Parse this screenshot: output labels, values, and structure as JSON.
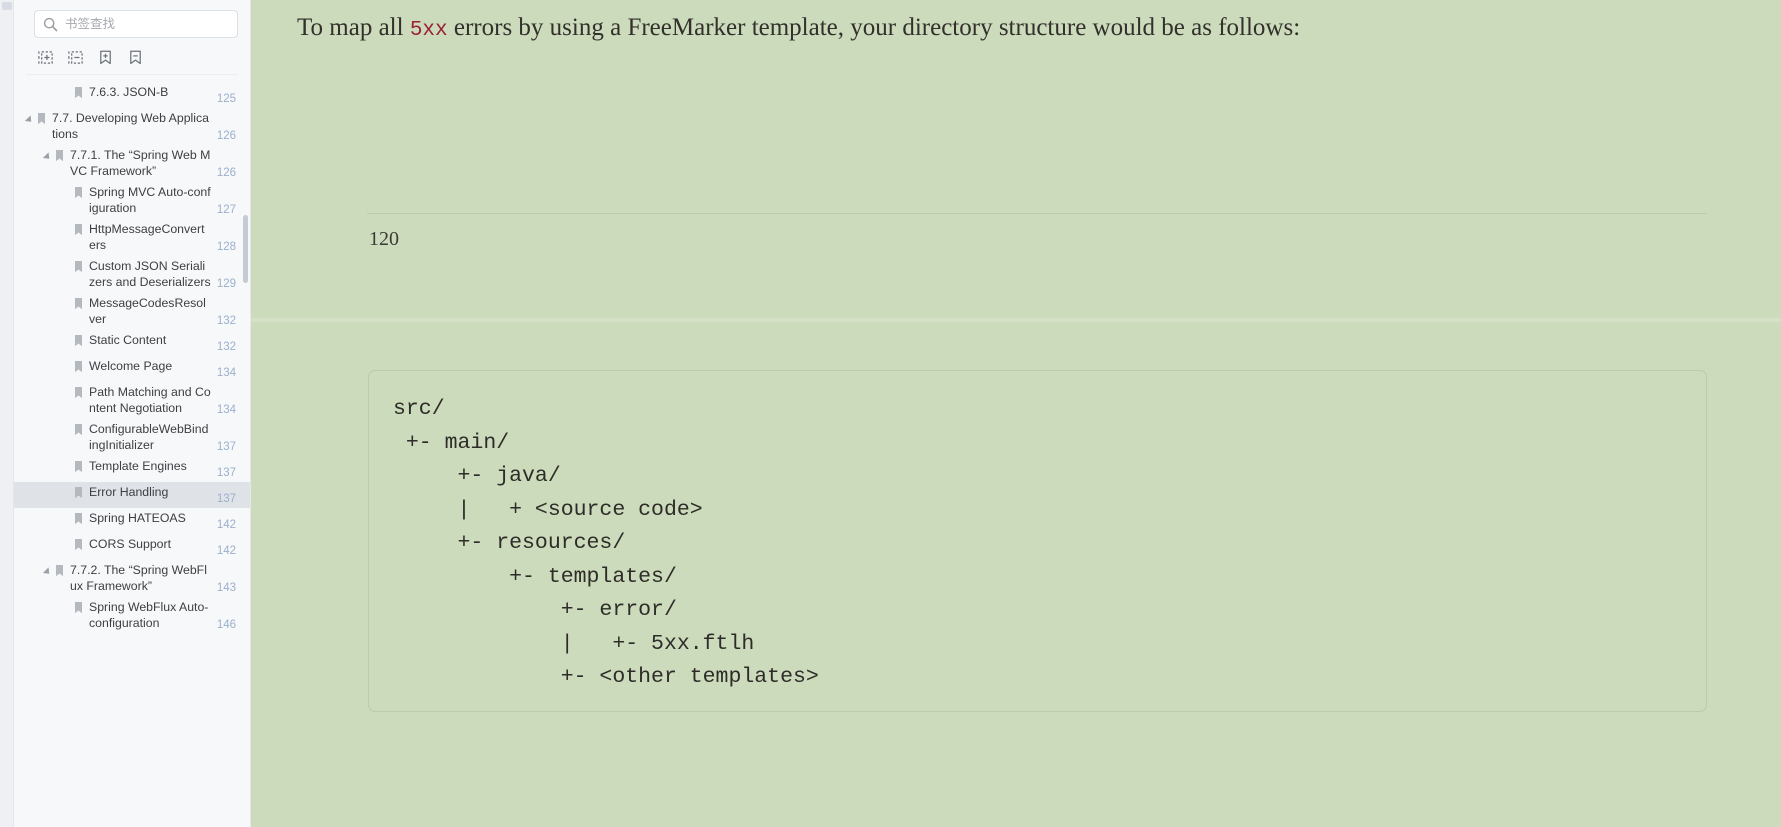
{
  "sidebar": {
    "search": {
      "placeholder": "书签查找",
      "value": "",
      "icon": "search-icon"
    },
    "toolbar": [
      {
        "id": "expand-all",
        "icon": "expand-all-icon",
        "title": "展开全部"
      },
      {
        "id": "collapse-all",
        "icon": "collapse-all-icon",
        "title": "收起全部"
      },
      {
        "id": "add-bookmark",
        "icon": "add-bookmark-icon",
        "title": "添加书签"
      },
      {
        "id": "remove-bookmark",
        "icon": "remove-bookmark-icon",
        "title": "删除书签"
      }
    ],
    "tree": [
      {
        "label": "7.6.3. JSON-B",
        "page": "125",
        "depth": 2,
        "expandable": false,
        "selected": false
      },
      {
        "label": "7.7. Developing Web Applications",
        "page": "126",
        "depth": 0,
        "expandable": true,
        "selected": false
      },
      {
        "label": "7.7.1. The “Spring Web MVC Framework”",
        "page": "126",
        "depth": 1,
        "expandable": true,
        "selected": false
      },
      {
        "label": "Spring MVC Auto-configuration",
        "page": "127",
        "depth": 2,
        "expandable": false,
        "selected": false
      },
      {
        "label": "HttpMessageConverters",
        "page": "128",
        "depth": 2,
        "expandable": false,
        "selected": false
      },
      {
        "label": "Custom JSON Serializers and Deserializers",
        "page": "129",
        "depth": 2,
        "expandable": false,
        "selected": false
      },
      {
        "label": "MessageCodesResolver",
        "page": "132",
        "depth": 2,
        "expandable": false,
        "selected": false
      },
      {
        "label": "Static Content",
        "page": "132",
        "depth": 2,
        "expandable": false,
        "selected": false
      },
      {
        "label": "Welcome Page",
        "page": "134",
        "depth": 2,
        "expandable": false,
        "selected": false
      },
      {
        "label": "Path Matching and Content Negotiation",
        "page": "134",
        "depth": 2,
        "expandable": false,
        "selected": false
      },
      {
        "label": "ConfigurableWebBindingInitializer",
        "page": "137",
        "depth": 2,
        "expandable": false,
        "selected": false
      },
      {
        "label": "Template Engines",
        "page": "137",
        "depth": 2,
        "expandable": false,
        "selected": false
      },
      {
        "label": "Error Handling",
        "page": "137",
        "depth": 2,
        "expandable": false,
        "selected": true
      },
      {
        "label": "Spring HATEOAS",
        "page": "142",
        "depth": 2,
        "expandable": false,
        "selected": false
      },
      {
        "label": "CORS Support",
        "page": "142",
        "depth": 2,
        "expandable": false,
        "selected": false
      },
      {
        "label": "7.7.2. The “Spring WebFlux Framework”",
        "page": "143",
        "depth": 1,
        "expandable": true,
        "selected": false
      },
      {
        "label": "Spring WebFlux Auto-configuration",
        "page": "146",
        "depth": 2,
        "expandable": false,
        "selected": false
      }
    ]
  },
  "viewer": {
    "page_one": {
      "paragraph_before": "To map all ",
      "paragraph_code": "5xx",
      "paragraph_after": " errors by using a FreeMarker template, your directory structure would be as follows:",
      "page_number": "120"
    },
    "page_two": {
      "code": "src/\n +- main/\n     +- java/\n     |   + <source code>\n     +- resources/\n         +- templates/\n             +- error/\n             |   +- 5xx.ftlh\n             +- <other templates>"
    }
  },
  "colors": {
    "page_background": "#ccdbbb",
    "inline_code": "#9b2035",
    "sidebar_background": "#f7f8fa",
    "selection": "#dfe3e8",
    "page_number_label": "#9bb0cc"
  }
}
